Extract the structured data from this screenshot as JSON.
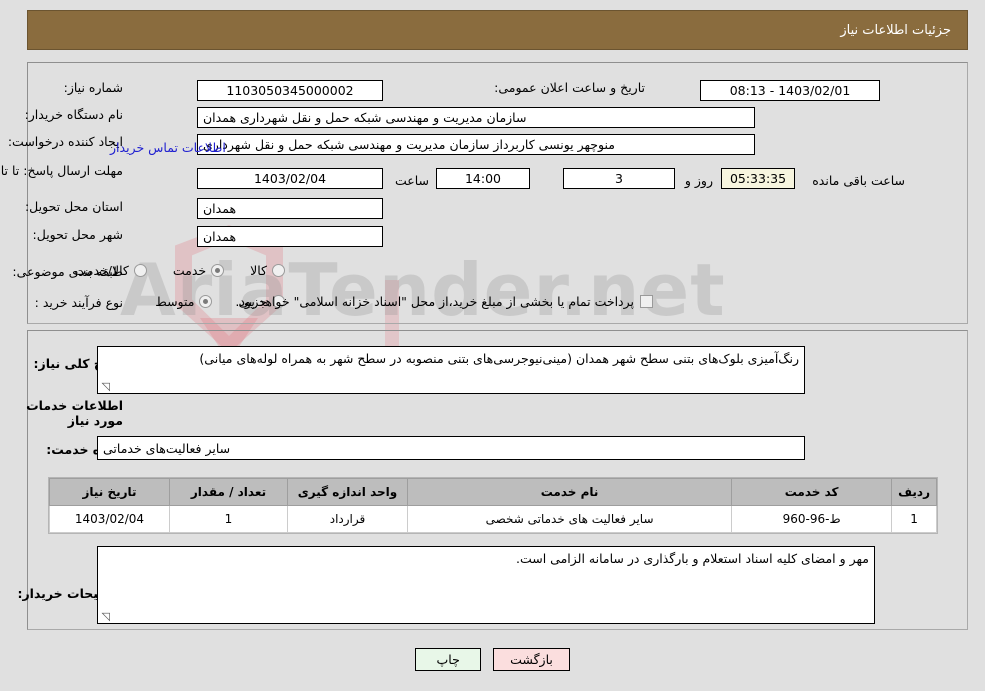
{
  "header": {
    "title": "جزئیات اطلاعات نیاز",
    "bg_color": "#8a6c3e"
  },
  "watermark": {
    "text": "AriaTender.net"
  },
  "top_section": {
    "need_number_label": "شماره نیاز:",
    "need_number_value": "1103050345000002",
    "announce_label": "تاریخ و ساعت اعلان عمومی:",
    "announce_value": "1403/02/01 - 08:13",
    "buyer_org_label": "نام دستگاه خریدار:",
    "buyer_org_value": "سازمان مدیریت و مهندسی شبکه حمل و نقل شهرداری همدان",
    "requester_label": "ایجاد کننده درخواست:",
    "requester_value": "منوچهر یونسی کاربرداز سازمان مدیریت و مهندسی شبکه حمل و نقل شهرداری",
    "buyer_contact_link": "اطلاعات تماس خریدار",
    "deadline_label": "مهلت ارسال پاسخ: تا تاریخ:",
    "deadline_date": "1403/02/04",
    "deadline_hour_label": "ساعت",
    "deadline_hour": "14:00",
    "days_remaining": "3",
    "days_label": "روز و",
    "countdown": "05:33:35",
    "countdown_label": "ساعت باقی مانده",
    "province_label": "استان محل تحویل:",
    "province_value": "همدان",
    "city_label": "شهر محل تحویل:",
    "city_value": "همدان",
    "category_label": "طبقه بندی موضوعی:",
    "category_options": [
      {
        "label": "کالا",
        "selected": false
      },
      {
        "label": "خدمت",
        "selected": true
      },
      {
        "label": "کالا/خدمت",
        "selected": false
      }
    ],
    "process_label": "نوع فرآیند خرید :",
    "process_options": [
      {
        "label": "جزیی",
        "selected": false
      },
      {
        "label": "متوسط",
        "selected": true
      }
    ],
    "treasury_checkbox_checked": false,
    "treasury_note": "پرداخت تمام یا بخشی از مبلغ خرید،از محل \"اسناد خزانه اسلامی\" خواهد بود."
  },
  "mid_section": {
    "summary_label": "شرح کلی نیاز:",
    "summary_value": "رنگ‌آمیزی بلوک‌های بتنی سطح شهر همدان (مینی‌نیوجرسی‌های بتنی منصوبه در سطح شهر به همراه لوله‌های میانی)",
    "services_heading": "اطلاعات خدمات مورد نیاز",
    "service_group_label": "گروه خدمت:",
    "service_group_value": "سایر فعالیت‌های خدماتی",
    "buyer_notes_label": "توضیحات خریدار:",
    "buyer_notes_value": "مهر و امضای کلیه اسناد استعلام و بارگذاری در سامانه الزامی است."
  },
  "table": {
    "columns": [
      "ردیف",
      "کد خدمت",
      "نام خدمت",
      "واحد اندازه گیری",
      "تعداد / مقدار",
      "تاریخ نیاز"
    ],
    "rows": [
      {
        "row_no": "1",
        "service_code": "ط-96-960",
        "service_name": "سایر فعالیت های خدماتی شخصی",
        "unit": "قرارداد",
        "quantity": "1",
        "need_date": "1403/02/04"
      }
    ]
  },
  "footer": {
    "print_label": "چاپ",
    "back_label": "بازگشت"
  }
}
